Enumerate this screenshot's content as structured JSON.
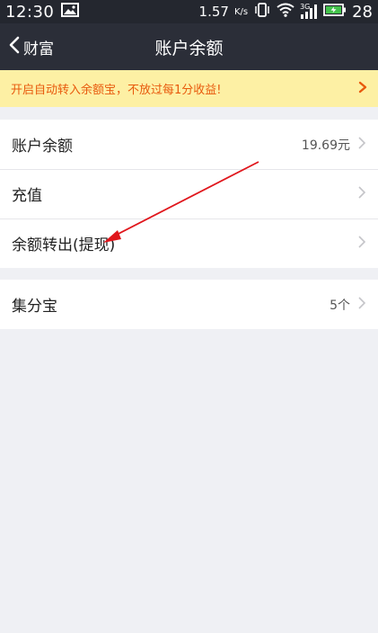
{
  "status_bar": {
    "time": "12:30",
    "speed": "1.57",
    "speed_unit": "K/s",
    "network": "3G",
    "battery": "28"
  },
  "nav": {
    "back_label": "财富",
    "title": "账户余额"
  },
  "banner": {
    "text": "开启自动转入余额宝，不放过每1分收益!"
  },
  "groups": [
    {
      "rows": [
        {
          "label": "账户余额",
          "value": "19.69元"
        },
        {
          "label": "充值",
          "value": ""
        },
        {
          "label": "余额转出(提现)",
          "value": ""
        }
      ]
    },
    {
      "rows": [
        {
          "label": "集分宝",
          "value": "5个"
        }
      ]
    }
  ],
  "colors": {
    "status_bg": "#24272f",
    "nav_bg": "#2b2e38",
    "banner_bg": "#fdf0a4",
    "banner_text": "#e8590c",
    "page_bg": "#eff0f4",
    "annotation_arrow": "#e0161c"
  }
}
